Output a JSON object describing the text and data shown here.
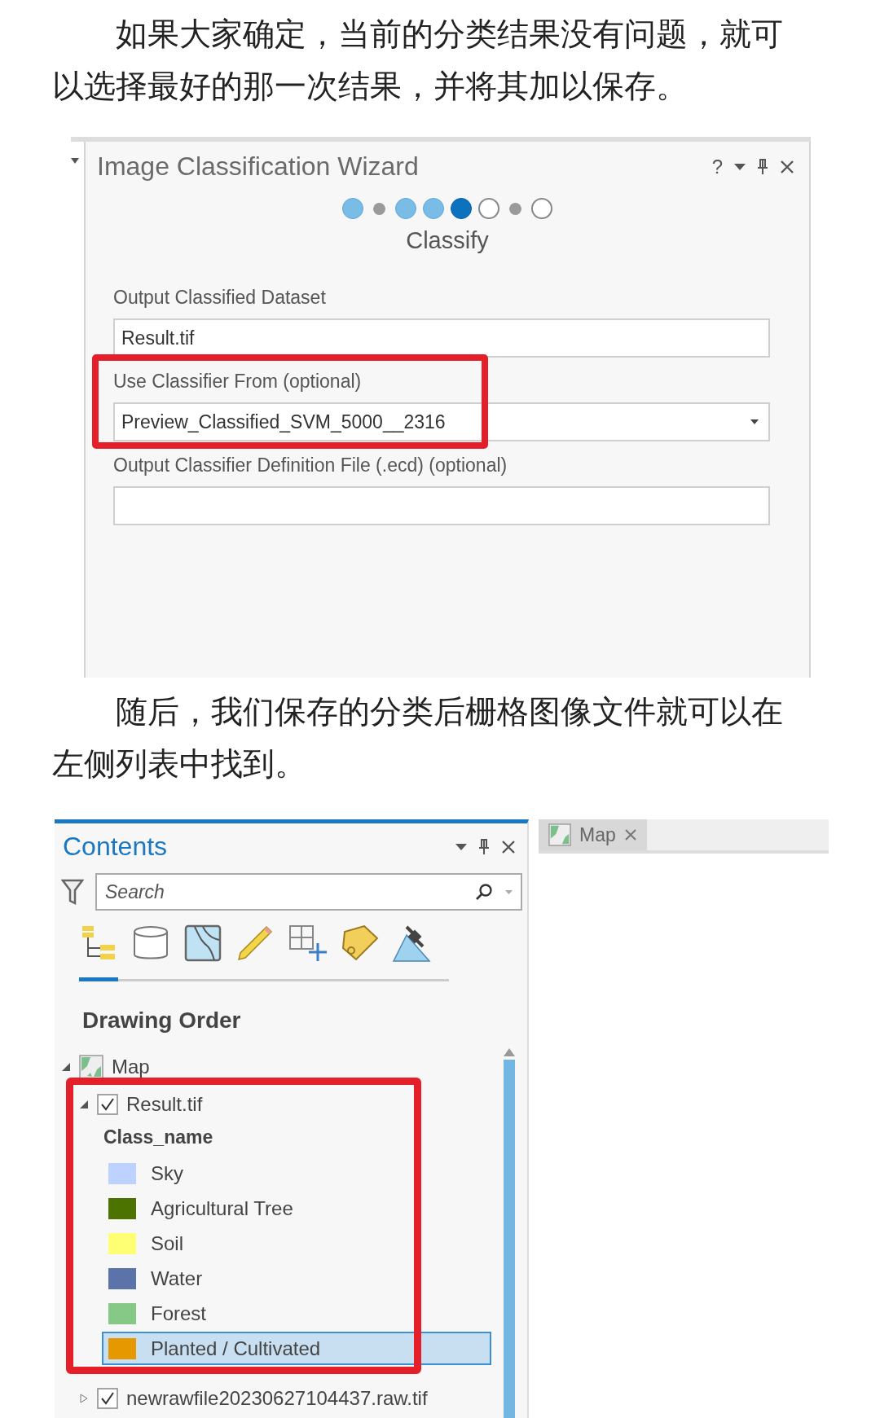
{
  "paragraphs": [
    "如果大家确定，当前的分类结果没有问题，就可以选择最好的那一次结果，并将其加以保存。",
    "随后，我们保存的分类后栅格图像文件就可以在左侧列表中找到。"
  ],
  "wizard": {
    "title": "Image Classification Wizard",
    "help": "?",
    "steps": [
      {
        "kind": "done"
      },
      {
        "kind": "minor"
      },
      {
        "kind": "done"
      },
      {
        "kind": "done"
      },
      {
        "kind": "current"
      },
      {
        "kind": "pending"
      },
      {
        "kind": "minor"
      },
      {
        "kind": "pending"
      }
    ],
    "step_name": "Classify",
    "fields": [
      {
        "label": "Output Classified Dataset",
        "value": "Result.tif",
        "kind": "text"
      },
      {
        "label": "Use Classifier From (optional)",
        "value": "Preview_Classified_SVM_5000__2316",
        "kind": "dropdown",
        "highlighted": true
      },
      {
        "label": "Output Classifier Definition File (.ecd) (optional)",
        "kind": "text"
      }
    ]
  },
  "contents": {
    "title": "Contents",
    "search": {
      "placeholder": "Search"
    },
    "view_tabs": [
      {
        "selected": true
      },
      {
        "selected": false
      },
      {
        "selected": false
      },
      {
        "selected": false
      },
      {
        "selected": false
      },
      {
        "selected": false
      },
      {
        "selected": false
      }
    ],
    "heading": "Drawing Order",
    "tree": [
      {
        "label": "Map",
        "kind": "map",
        "expanded": true,
        "children": [
          {
            "label": "Result.tif",
            "kind": "layer",
            "checked": true,
            "expanded": true,
            "highlighted": true,
            "legend": {
              "heading": "Class_name",
              "classes": [
                {
                  "label": "Sky",
                  "color": "#bed2ff",
                  "selected": false
                },
                {
                  "label": "Agricultural Tree",
                  "color": "#4c7300",
                  "selected": false
                },
                {
                  "label": "Soil",
                  "color": "#ffff73",
                  "selected": false
                },
                {
                  "label": "Water",
                  "color": "#5b73a8",
                  "selected": false
                },
                {
                  "label": "Forest",
                  "color": "#86c987",
                  "selected": false
                },
                {
                  "label": "Planted / Cultivated",
                  "color": "#e69800",
                  "selected": true
                }
              ]
            }
          },
          {
            "label": "newrawfile20230627104437.raw.tif",
            "kind": "layer",
            "checked": true,
            "expanded": false
          }
        ]
      }
    ]
  },
  "map_tab": {
    "label": "Map"
  }
}
